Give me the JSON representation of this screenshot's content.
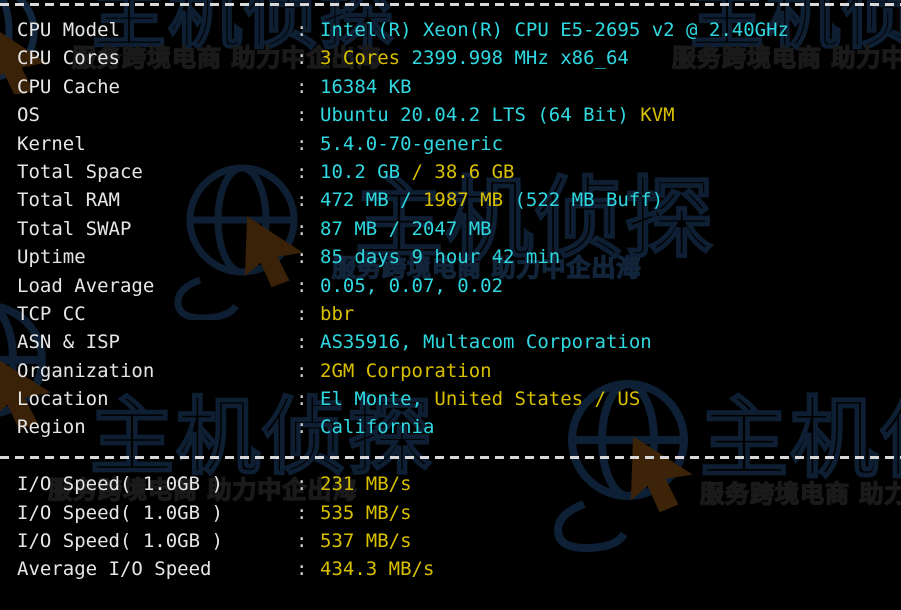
{
  "terminal": {
    "colon": ":",
    "separator_top": "----------------------------------------------------------------------",
    "separator_mid": "----------------------------------------------------------------------",
    "colors": {
      "background": "#000000",
      "label": "#e6e6e6",
      "cyan": "#2fd8e0",
      "yellow": "#d8bf00",
      "separator": "#d8d8d8"
    },
    "system_info": [
      {
        "label": "CPU Model",
        "segments": [
          {
            "text": "Intel(R) Xeon(R) CPU E5-2695 v2 @ 2.40GHz",
            "color": "cyan"
          }
        ]
      },
      {
        "label": "CPU Cores",
        "segments": [
          {
            "text": "3 Cores ",
            "color": "yellow"
          },
          {
            "text": "2399.998 MHz x86_64",
            "color": "cyan"
          }
        ]
      },
      {
        "label": "CPU Cache",
        "segments": [
          {
            "text": "16384 KB",
            "color": "cyan"
          }
        ]
      },
      {
        "label": "OS",
        "segments": [
          {
            "text": "Ubuntu 20.04.2 LTS (64 Bit) ",
            "color": "cyan"
          },
          {
            "text": "KVM",
            "color": "yellow"
          }
        ]
      },
      {
        "label": "Kernel",
        "segments": [
          {
            "text": "5.4.0-70-generic",
            "color": "cyan"
          }
        ]
      },
      {
        "label": "Total Space",
        "segments": [
          {
            "text": "10.2 GB ",
            "color": "cyan"
          },
          {
            "text": "/ 38.6 GB",
            "color": "yellow"
          }
        ]
      },
      {
        "label": "Total RAM",
        "segments": [
          {
            "text": "472 MB / ",
            "color": "cyan"
          },
          {
            "text": "1987 MB ",
            "color": "yellow"
          },
          {
            "text": "(522 MB Buff)",
            "color": "cyan"
          }
        ]
      },
      {
        "label": "Total SWAP",
        "segments": [
          {
            "text": "87 MB / 2047 MB",
            "color": "cyan"
          }
        ]
      },
      {
        "label": "Uptime",
        "segments": [
          {
            "text": "85 days 9 hour 42 min",
            "color": "cyan"
          }
        ]
      },
      {
        "label": "Load Average",
        "segments": [
          {
            "text": "0.05, 0.07, 0.02",
            "color": "cyan"
          }
        ]
      },
      {
        "label": "TCP CC",
        "segments": [
          {
            "text": "bbr",
            "color": "yellow"
          }
        ]
      },
      {
        "label": "ASN & ISP",
        "segments": [
          {
            "text": "AS35916, Multacom Corporation",
            "color": "cyan"
          }
        ]
      },
      {
        "label": "Organization",
        "segments": [
          {
            "text": "2GM Corporation",
            "color": "yellow"
          }
        ]
      },
      {
        "label": "Location",
        "segments": [
          {
            "text": "El Monte, ",
            "color": "cyan"
          },
          {
            "text": "United States / US",
            "color": "yellow"
          }
        ]
      },
      {
        "label": "Region",
        "segments": [
          {
            "text": "California",
            "color": "cyan"
          }
        ]
      }
    ],
    "io_results": [
      {
        "label": "I/O Speed( 1.0GB )",
        "segments": [
          {
            "text": "231 MB/s",
            "color": "yellow"
          }
        ]
      },
      {
        "label": "I/O Speed( 1.0GB )",
        "segments": [
          {
            "text": "535 MB/s",
            "color": "yellow"
          }
        ]
      },
      {
        "label": "I/O Speed( 1.0GB )",
        "segments": [
          {
            "text": "537 MB/s",
            "color": "yellow"
          }
        ]
      },
      {
        "label": "Average I/O Speed",
        "segments": [
          {
            "text": "434.3 MB/s",
            "color": "yellow"
          }
        ]
      }
    ]
  },
  "watermarks": {
    "brand_cn": "主机侦探",
    "tagline_cn": "服务跨境电商 助力中企出海",
    "logo_icon": "globe-cursor-logo"
  }
}
